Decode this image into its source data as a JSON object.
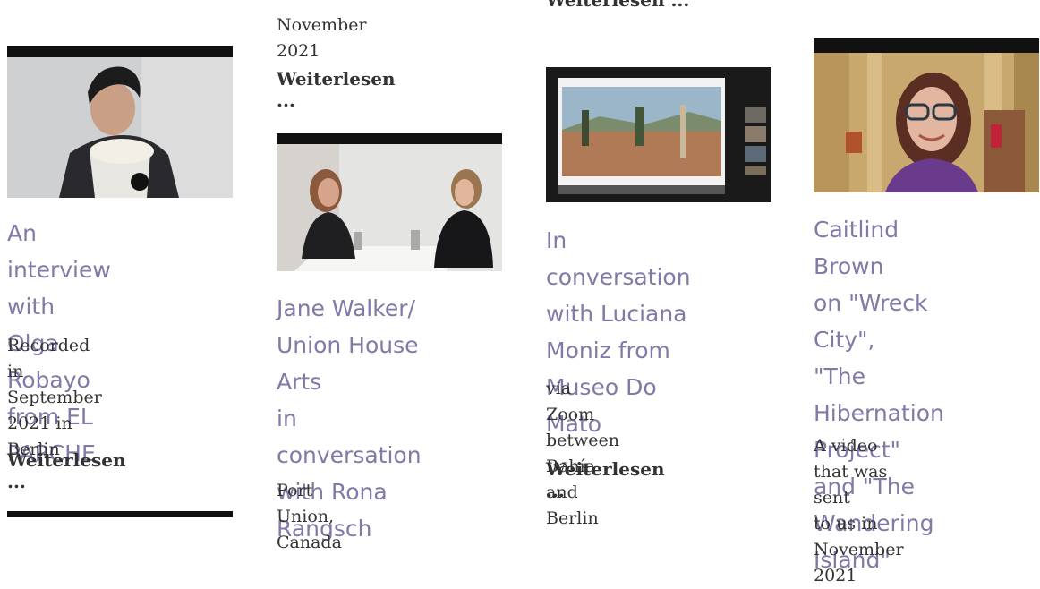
{
  "read_more_label": "Weiterlesen ...",
  "cards": [
    {
      "title_lines": [
        "An interview with",
        "Olga Robayo",
        "from EL PARCHE"
      ],
      "desc_lines": [
        "Recorded in",
        "September 2021 in",
        "Berlin"
      ],
      "read_more": "Weiterlesen ..."
    },
    {
      "prev_desc_tail": "November 2021",
      "prev_read_more": "Weiterlesen ...",
      "title_lines": [
        "Jane Walker/",
        "Union House Arts",
        "in conversation",
        "with Rona",
        "Rangsch"
      ],
      "desc_lines": [
        "Port Union, Canada"
      ]
    },
    {
      "prev_read_more_cut": "Weiterlesen ...",
      "title_lines": [
        "In conversation",
        "with Luciana",
        "Moniz from",
        "Museo Do Mato"
      ],
      "desc_lines": [
        "via Zoom between",
        "Bahía and Berlin"
      ],
      "read_more": "Weiterlesen ..."
    },
    {
      "title_lines": [
        "Caitlind Brown",
        "on \"Wreck City\",",
        "\"The Hibernation",
        "Project\" and \"The",
        "Wandering",
        "Island\""
      ],
      "desc_lines": [
        "A video that was sent",
        "to us in November",
        "2021"
      ]
    }
  ]
}
